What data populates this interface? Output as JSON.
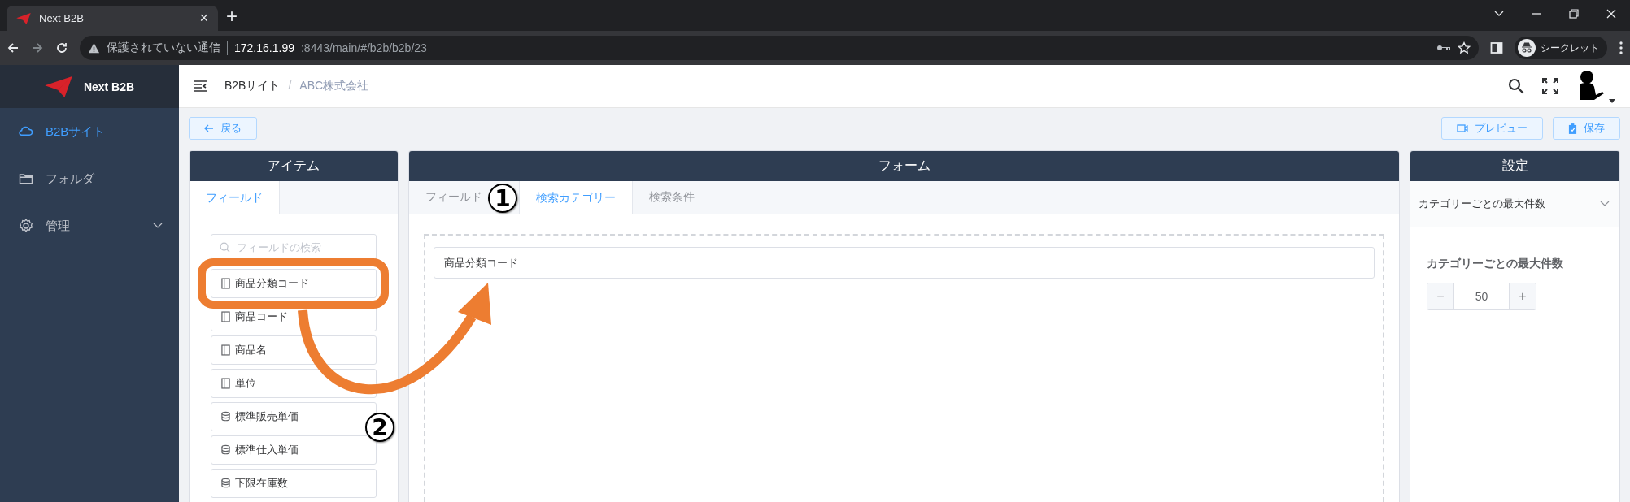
{
  "browser": {
    "tab_title": "Next B2B",
    "close_tab": "×",
    "new_tab": "+",
    "security": "保護されていない通信",
    "url_host": "172.16.1.99",
    "url_rest": ":8443/main/#/b2b/b2b/23",
    "incognito": "シークレット"
  },
  "sidebar": {
    "brand": "Next B2B",
    "items": [
      {
        "label": "B2Bサイト",
        "kind": "cloud",
        "selected": true,
        "expandable": false
      },
      {
        "label": "フォルダ",
        "kind": "folder",
        "selected": false,
        "expandable": false
      },
      {
        "label": "管理",
        "kind": "gear",
        "selected": false,
        "expandable": true
      }
    ]
  },
  "header": {
    "breadcrumb": [
      "B2Bサイト",
      "ABC株式会社"
    ],
    "separator": "/"
  },
  "toolbar": {
    "back": "戻る",
    "preview": "プレビュー",
    "save": "保存"
  },
  "items_panel": {
    "title": "アイテム",
    "tabs": [
      {
        "label": "フィールド",
        "selected": true
      }
    ],
    "search": {
      "placeholder": "フィールドの検索"
    },
    "fields": [
      {
        "label": "商品分類コード",
        "kind": "text"
      },
      {
        "label": "商品コード",
        "kind": "text"
      },
      {
        "label": "商品名",
        "kind": "text"
      },
      {
        "label": "単位",
        "kind": "text"
      },
      {
        "label": "標準販売単価",
        "kind": "number"
      },
      {
        "label": "標準仕入単価",
        "kind": "number"
      },
      {
        "label": "下限在庫数",
        "kind": "number"
      }
    ]
  },
  "form_panel": {
    "title": "フォーム",
    "tabs": [
      {
        "label": "フィールド",
        "selected": false
      },
      {
        "label": "検索カテゴリー",
        "selected": true
      },
      {
        "label": "検索条件",
        "selected": false
      }
    ],
    "placed_fields": [
      "商品分類コード"
    ]
  },
  "settings_panel": {
    "title": "設定",
    "section": {
      "title": "カテゴリーごとの最大件数",
      "expanded": true
    },
    "max_per_category": {
      "label": "カテゴリーごとの最大件数",
      "value": "50",
      "decrement": "−",
      "increment": "+"
    }
  },
  "annotations": {
    "markers": [
      "1",
      "2"
    ]
  }
}
